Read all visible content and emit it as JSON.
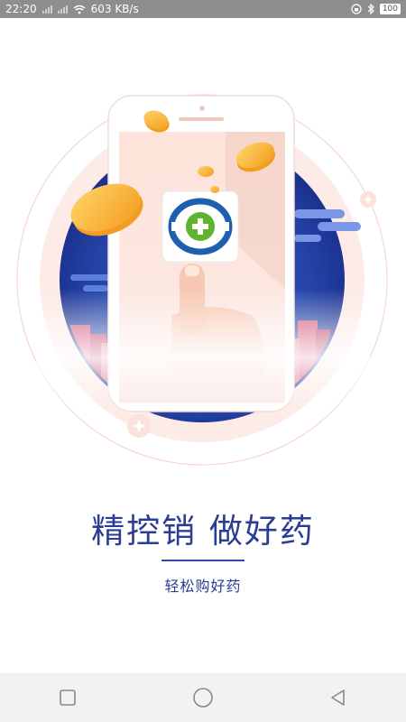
{
  "status_bar": {
    "time": "22:20",
    "network_speed": "603 KB/s",
    "battery": "100",
    "icons": [
      "signal-icon",
      "wifi-icon",
      "lock-rotation-icon",
      "bluetooth-icon",
      "battery-icon"
    ]
  },
  "splash": {
    "headline": "精控销 做好药",
    "subline": "轻松购好药",
    "brand_colors": {
      "primary_blue": "#2a3d93",
      "logo_green": "#5fb32f",
      "coin_gold": "#f7b330"
    }
  },
  "nav_bar": {
    "icons": [
      "recent-apps-icon",
      "home-icon",
      "back-icon"
    ]
  }
}
